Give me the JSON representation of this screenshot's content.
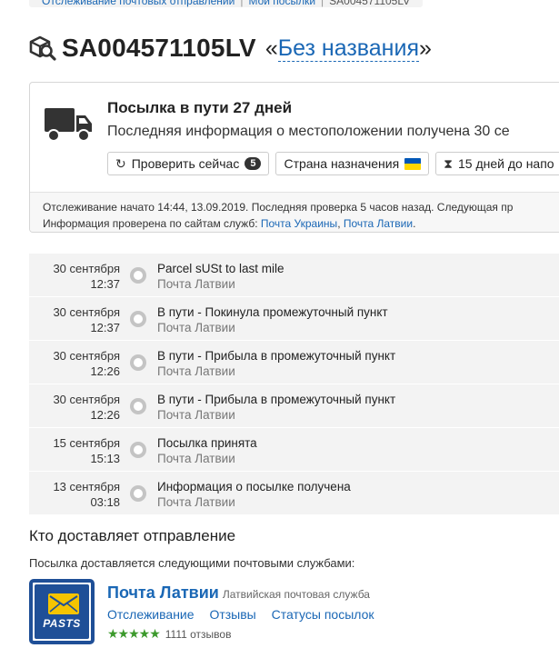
{
  "breadcrumb": {
    "items": [
      "Отслеживание почтовых отправлений",
      "Мои посылки",
      "SA004571105LV"
    ]
  },
  "title": {
    "track_number": "SA004571105LV",
    "name_open": "«",
    "name": "Без названия",
    "name_close": "»"
  },
  "status": {
    "headline": "Посылка в пути 27 дней",
    "subline": "Последняя информация о местоположении получена 30 се",
    "check_label": "Проверить сейчас",
    "check_count": "5",
    "destination_label": "Страна назначения",
    "days_label": "15 дней до напо",
    "info_line1": "Отслеживание начато 14:44, 13.09.2019. Последняя проверка 5 часов назад. Следующая пр",
    "info_line2_prefix": "Информация проверена по сайтам служб: ",
    "service1": "Почта Украины",
    "comma": ", ",
    "service2": "Почта Латвии",
    "info_line2_suffix": "."
  },
  "events": [
    {
      "date": "30 сентября",
      "time": "12:37",
      "text": "Parcel sUSt to last mile",
      "service": "Почта Латвии"
    },
    {
      "date": "30 сентября",
      "time": "12:37",
      "text": "В пути - Покинула промежуточный пункт",
      "service": "Почта Латвии"
    },
    {
      "date": "30 сентября",
      "time": "12:26",
      "text": "В пути - Прибыла в промежуточный пункт",
      "service": "Почта Латвии"
    },
    {
      "date": "30 сентября",
      "time": "12:26",
      "text": "В пути - Прибыла в промежуточный пункт",
      "service": "Почта Латвии"
    },
    {
      "date": "15 сентября",
      "time": "15:13",
      "text": "Посылка принята",
      "service": "Почта Латвии"
    },
    {
      "date": "13 сентября",
      "time": "03:18",
      "text": "Информация о посылке получена",
      "service": "Почта Латвии"
    }
  ],
  "delivery": {
    "heading": "Кто доставляет отправление",
    "subheading": "Посылка доставляется следующими почтовыми службами:",
    "carrier_name": "Почта Латвии",
    "carrier_desc": "Латвийская почтовая служба",
    "logo_text": "PASTS",
    "links": [
      "Отслеживание",
      "Отзывы",
      "Статусы посылок"
    ],
    "stars": "★★★★★",
    "rating": 4.5,
    "reviews": "1111 отзывов"
  },
  "colors": {
    "link": "#1a67b5",
    "logo_blue": "#1f4f97",
    "logo_yellow": "#f5c400",
    "stars": "#3c9a2c",
    "flag_blue": "#0057b7",
    "flag_yellow": "#ffd700"
  }
}
